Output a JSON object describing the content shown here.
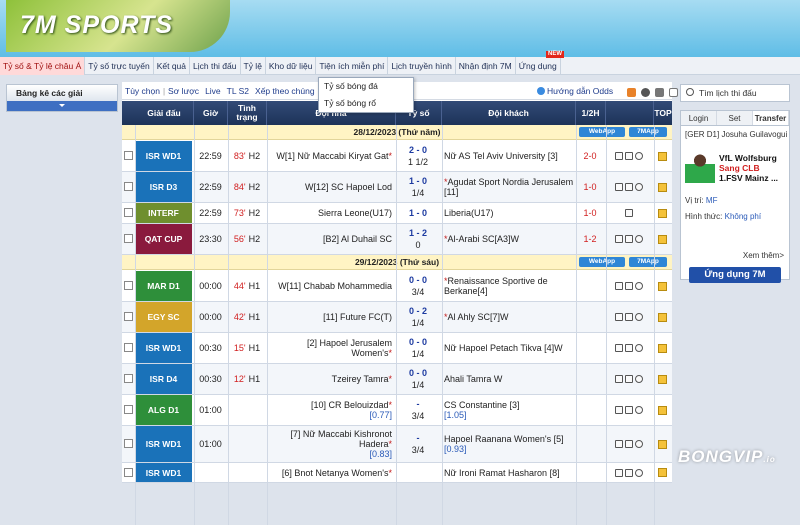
{
  "logo_text": "7M SPORTS",
  "nav": [
    "Tỷ số & Tỷ lệ châu Á",
    "Tỷ số trực tuyến",
    "Kết quả",
    "Lịch thi đấu",
    "Tỷ lệ",
    "Kho dữ liệu",
    "Tiện ích miễn phí",
    "Lịch truyền hình",
    "Nhận định 7M",
    "Ứng dụng"
  ],
  "new_badge": "NEW",
  "left": {
    "title": "Bảng kê các giải"
  },
  "toolbar": {
    "items": [
      "Tùy chọn",
      "Sơ lược",
      "Live",
      "TL S2",
      "Xếp theo chúng"
    ],
    "odds_guide": "Hướng dẫn Odds"
  },
  "dropdown": [
    "Tỷ số bóng đá",
    "Tỷ số bóng rổ"
  ],
  "columns": {
    "league": "Giải đấu",
    "time": "Giờ",
    "status": "Tình trạng",
    "home": "Đội nhà",
    "score": "Tỷ số",
    "away": "Đội khách",
    "ht": "1/2H",
    "top": "TOP"
  },
  "dates": [
    {
      "label": "28/12/2023 (Thứ năm)",
      "webapp": "WebApp",
      "mapp": "7MApp"
    },
    {
      "label": "29/12/2023 (Thứ sáu)",
      "webapp": "WebApp",
      "mapp": "7MApp"
    }
  ],
  "matches": [
    {
      "league": "ISR WD1",
      "color": "#1a72b9",
      "time": "22:59",
      "minute": "83'",
      "phase": "H2",
      "home": "W[1] Nữ Maccabi Kiryat Gat",
      "home_star": "*",
      "home_odd": "",
      "score": "2 - 0",
      "sub": "1 1/2",
      "away_star": "",
      "away": "Nữ AS Tel Aviv University [3]",
      "away_odd": "",
      "ht": "2-0"
    },
    {
      "league": "ISR D3",
      "color": "#1a72b9",
      "time": "22:59",
      "minute": "84'",
      "phase": "H2",
      "home": "W[12] SC Hapoel Lod",
      "home_star": "",
      "home_odd": "",
      "score": "1 - 0",
      "sub": "1/4",
      "away_star": "*",
      "away": "Agudat Sport Nordia Jerusalem [11]",
      "away_odd": "",
      "ht": "1-0"
    },
    {
      "league": "INTERF",
      "color": "#6f8f2e",
      "time": "22:59",
      "minute": "73'",
      "phase": "H2",
      "home": "Sierra Leone(U17)",
      "home_star": "",
      "home_odd": "",
      "score": "1 - 0",
      "sub": "",
      "away_star": "",
      "away": "Liberia(U17)",
      "away_odd": "",
      "ht": "1-0"
    },
    {
      "league": "QAT CUP",
      "color": "#8a1a3d",
      "time": "23:30",
      "minute": "56'",
      "phase": "H2",
      "home": "[B2] Al Duhail SC",
      "home_star": "",
      "home_odd": "",
      "score": "1 - 2",
      "sub": "0",
      "away_star": "*",
      "away": "Al-Arabi SC[A3]W",
      "away_odd": "",
      "ht": "1-2"
    },
    {
      "league": "MAR D1",
      "color": "#2e8f3a",
      "time": "00:00",
      "minute": "44'",
      "phase": "H1",
      "home": "W[11] Chabab Mohammedia",
      "home_star": "",
      "home_odd": "",
      "score": "0 - 0",
      "sub": "3/4",
      "away_star": "*",
      "away": "Renaissance Sportive de Berkane[4]",
      "away_odd": "",
      "ht": ""
    },
    {
      "league": "EGY SC",
      "color": "#d3a52a",
      "time": "00:00",
      "minute": "42'",
      "phase": "H1",
      "home": "[11] Future FC(T)",
      "home_star": "",
      "home_odd": "",
      "score": "0 - 2",
      "sub": "1/4",
      "away_star": "*",
      "away": "Al Ahly SC[7]W",
      "away_odd": "",
      "ht": ""
    },
    {
      "league": "ISR WD1",
      "color": "#1a72b9",
      "time": "00:30",
      "minute": "15'",
      "phase": "H1",
      "home": "[2] Hapoel Jerusalem Women's",
      "home_star": "*",
      "home_odd": "",
      "score": "0 - 0",
      "sub": "1/4",
      "away_star": "",
      "away": "Nữ Hapoel Petach Tikva [4]W",
      "away_odd": "",
      "ht": ""
    },
    {
      "league": "ISR D4",
      "color": "#1a72b9",
      "time": "00:30",
      "minute": "12'",
      "phase": "H1",
      "home": "Tzeirey Tamra",
      "home_star": "*",
      "home_odd": "",
      "score": "0 - 0",
      "sub": "1/4",
      "away_star": "",
      "away": "Ahali Tamra W",
      "away_odd": "",
      "ht": ""
    },
    {
      "league": "ALG D1",
      "color": "#2e8f3a",
      "time": "01:00",
      "minute": "",
      "phase": "",
      "home": "[10] CR Belouizdad",
      "home_star": "*",
      "home_odd": "[0.77]",
      "score": "-",
      "sub": "3/4",
      "away_star": "",
      "away": "CS Constantine [3]",
      "away_odd": "[1.05]",
      "ht": ""
    },
    {
      "league": "ISR WD1",
      "color": "#1a72b9",
      "time": "01:00",
      "minute": "",
      "phase": "",
      "home": "[7] Nữ Maccabi Kishronot Hadera",
      "home_star": "*",
      "home_odd": "[0.83]",
      "score": "-",
      "sub": "3/4",
      "away_star": "",
      "away": "Hapoel Raanana Women's [5]",
      "away_odd": "[0.93]",
      "ht": ""
    },
    {
      "league": "ISR WD1",
      "color": "#1a72b9",
      "time": "",
      "minute": "",
      "phase": "",
      "home": "[6] Bnot Netanya Women's",
      "home_star": "*",
      "home_odd": "",
      "score": "",
      "sub": "",
      "away_star": "",
      "away": "Nữ Ironi Ramat Hasharon [8]",
      "away_odd": "",
      "ht": ""
    }
  ],
  "right": {
    "search_placeholder": "Tìm lịch thi đấu",
    "tabs": [
      "Login",
      "Set",
      "Transfer"
    ],
    "league": "[GER D1] Josuha Guilavogui",
    "club_from": "VfL Wolfsburg",
    "move": "Sang CLB",
    "club_to": "1.FSV Mainz ...",
    "position_label": "Vị trí:",
    "position": "MF",
    "form_label": "Hình thức:",
    "form": "Không phí",
    "more": "Xem thêm>",
    "app_button": "Ứng dụng 7M"
  },
  "watermark": "BONGVIP",
  "watermark_suffix": ".io"
}
